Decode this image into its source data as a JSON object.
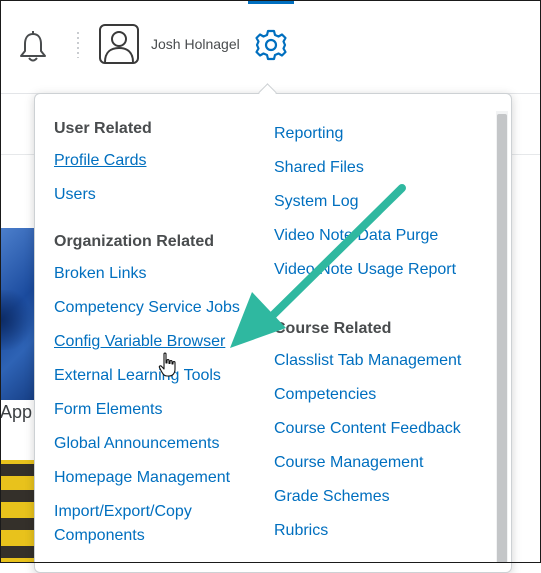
{
  "header": {
    "user_name": "Josh Holnagel",
    "icons": [
      "bell-icon",
      "avatar-icon",
      "gear-icon"
    ],
    "accent_color": "#006fbf"
  },
  "background": {
    "partial_text": "App"
  },
  "menu": {
    "left_column": {
      "user_related": {
        "heading": "User Related",
        "items": [
          "Profile Cards",
          "Users"
        ]
      },
      "organization_related": {
        "heading": "Organization Related",
        "items": [
          "Broken Links",
          "Competency Service Jobs",
          "Config Variable Browser",
          "External Learning Tools",
          "Form Elements",
          "Global Announcements",
          "Homepage Management",
          "Import/Export/Copy Components"
        ]
      }
    },
    "right_column": {
      "org_items": [
        "Reporting",
        "Shared Files",
        "System Log",
        "Video Note Data Purge",
        "Video Note Usage Report"
      ],
      "course_related": {
        "heading": "Course Related",
        "items": [
          "Classlist Tab Management",
          "Competencies",
          "Course Content Feedback",
          "Course Management",
          "Grade Schemes",
          "Rubrics"
        ]
      }
    },
    "link_color": "#006fbf",
    "heading_color": "#494c4e"
  },
  "annotation": {
    "arrow_color": "#2fb8a0",
    "target": "Config Variable Browser"
  }
}
